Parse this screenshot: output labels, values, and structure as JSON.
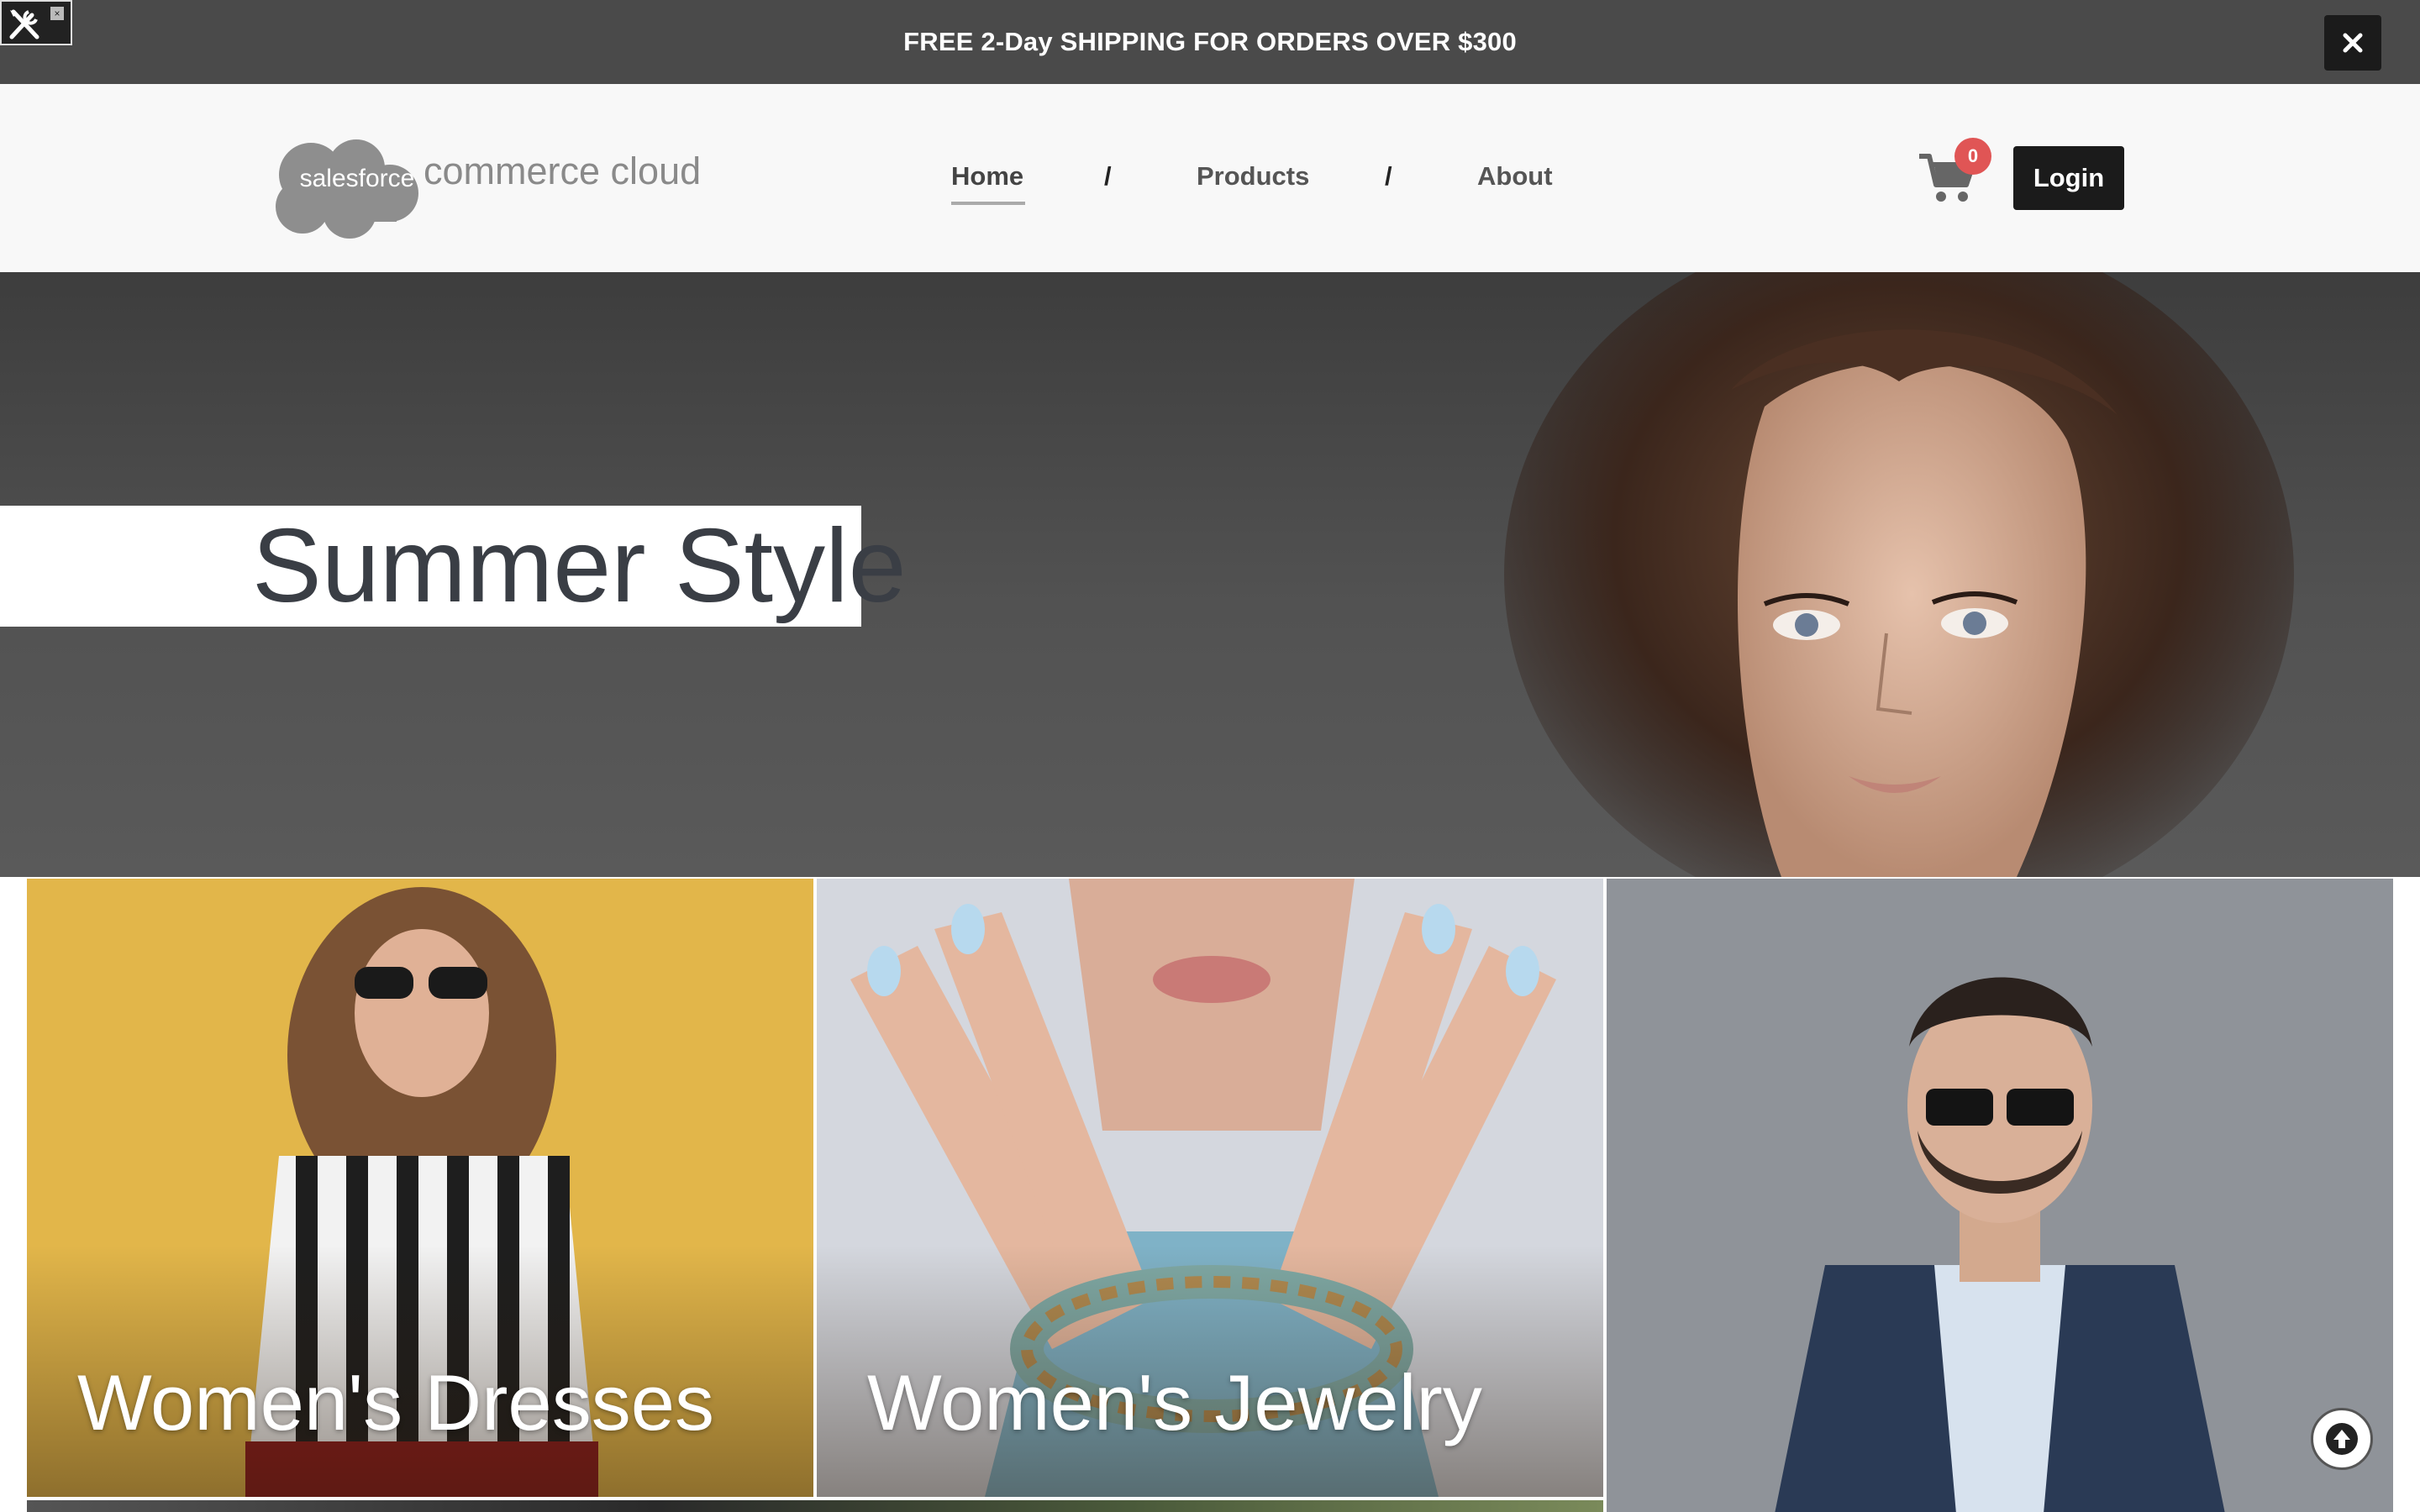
{
  "promo": {
    "text": "FREE 2-Day SHIPPING FOR ORDERS OVER $300",
    "close_icon": "close-icon"
  },
  "header": {
    "logo": {
      "cloud_text": "salesforce",
      "product_text": "commerce cloud"
    },
    "nav": [
      {
        "label": "Home",
        "active": true
      },
      {
        "label": "Products",
        "active": false
      },
      {
        "label": "About",
        "active": false
      }
    ],
    "separator": "/",
    "cart_count": "0",
    "login_label": "Login"
  },
  "hero": {
    "title": "Summer Style"
  },
  "tiles": [
    {
      "label": "Women's Dresses"
    },
    {
      "label": "Women's Jewelry"
    },
    {
      "label": ""
    }
  ],
  "colors": {
    "promo_bg": "#4a4a4a",
    "header_bg": "#f8f8f8",
    "badge": "#e05555",
    "button_dark": "#1b1b1b"
  }
}
